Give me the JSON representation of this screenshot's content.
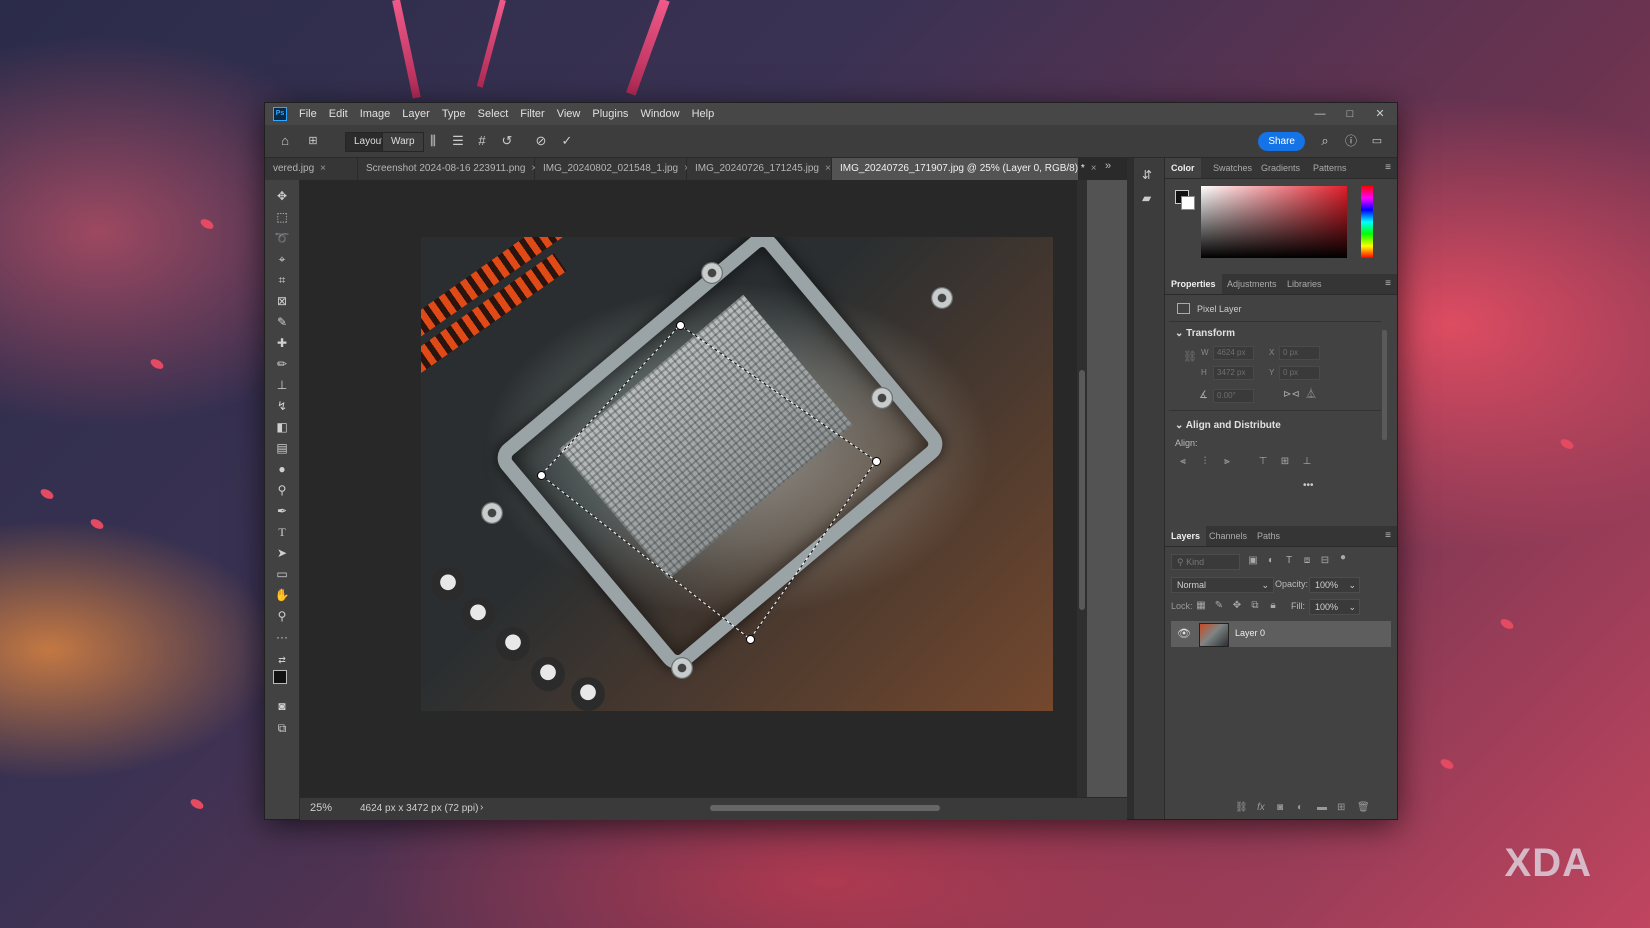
{
  "background": {
    "watermark_text": "XDA",
    "accent_color": "#e44a62"
  },
  "titlebar": {
    "app_icon": "Ps",
    "menu": [
      "File",
      "Edit",
      "Image",
      "Layer",
      "Type",
      "Select",
      "Filter",
      "View",
      "Plugins",
      "Window",
      "Help"
    ],
    "controls": {
      "minimize": "—",
      "maximize": "□",
      "close": "✕"
    }
  },
  "options_bar": {
    "layout_label": "Layout",
    "warp_label": "Warp",
    "share_label": "Share",
    "icons": [
      "home-icon",
      "warp-mode-icon",
      "split-vertical-icon",
      "split-horizontal-icon",
      "grid-icon",
      "reset-icon",
      "cancel-icon",
      "commit-icon",
      "search-icon",
      "help-icon",
      "workspace-icon"
    ]
  },
  "tabs": [
    {
      "label": "vered.jpg",
      "active": false
    },
    {
      "label": "Screenshot 2024-08-16 223911.png",
      "active": false
    },
    {
      "label": "IMG_20240802_021548_1.jpg",
      "active": false
    },
    {
      "label": "IMG_20240726_171245.jpg",
      "active": false
    },
    {
      "label": "IMG_20240726_171907.jpg @ 25% (Layer 0, RGB/8) *",
      "active": true
    }
  ],
  "status": {
    "zoom": "25%",
    "doc_info": "4624 px x 3472 px (72 ppi)",
    "arrow": "›"
  },
  "color_panel": {
    "tabs": [
      "Color",
      "Swatches",
      "Gradients",
      "Patterns"
    ],
    "active_tab": "Color",
    "hue_color": "#e01e2a"
  },
  "properties_panel": {
    "tabs": [
      "Properties",
      "Adjustments",
      "Libraries"
    ],
    "active_tab": "Properties",
    "layer_type": "Pixel Layer",
    "transform_heading": "Transform",
    "w_label": "W",
    "w_value": "4624 px",
    "h_label": "H",
    "h_value": "3472 px",
    "x_label": "X",
    "x_value": "0 px",
    "y_label": "Y",
    "y_value": "0 px",
    "angle_value": "0.00°",
    "align_heading": "Align and Distribute",
    "align_label": "Align:",
    "more": "•••"
  },
  "layers_panel": {
    "tabs": [
      "Layers",
      "Channels",
      "Paths"
    ],
    "active_tab": "Layers",
    "kind_placeholder": "Kind",
    "blend_mode": "Normal",
    "opacity_label": "Opacity:",
    "opacity_value": "100%",
    "lock_label": "Lock:",
    "fill_label": "Fill:",
    "fill_value": "100%",
    "layers": [
      {
        "name": "Layer 0",
        "visible": true
      }
    ]
  }
}
